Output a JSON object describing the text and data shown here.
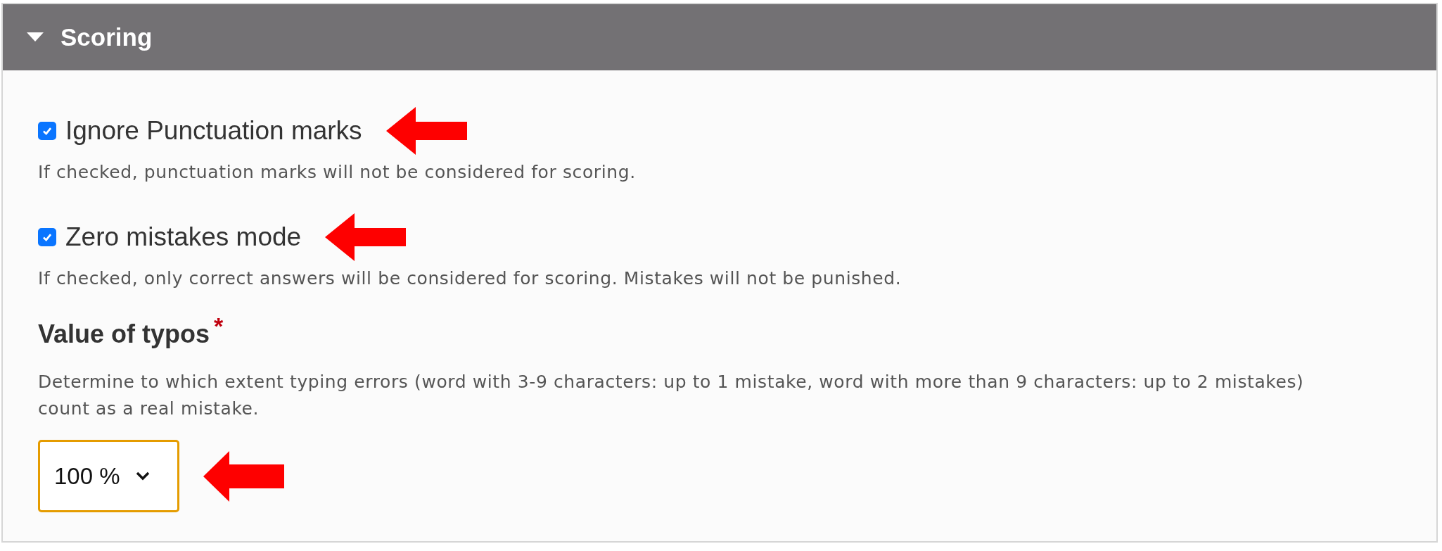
{
  "section": {
    "title": "Scoring",
    "expanded": true
  },
  "options": [
    {
      "kind": "checkbox",
      "label": "Ignore Punctuation marks",
      "checked": true,
      "description": "If checked, punctuation marks will not be considered for scoring."
    },
    {
      "kind": "checkbox",
      "label": "Zero mistakes mode",
      "checked": true,
      "description": "If checked, only correct answers will be considered for scoring. Mistakes will not be punished."
    },
    {
      "kind": "select",
      "label": "Value of typos",
      "required_mark": "*",
      "description": "Determine to which extent typing errors (word with 3-9 characters: up to 1 mistake, word with more than 9 characters: up to 2 mistakes) count as a real mistake.",
      "value": "100 %"
    }
  ]
}
